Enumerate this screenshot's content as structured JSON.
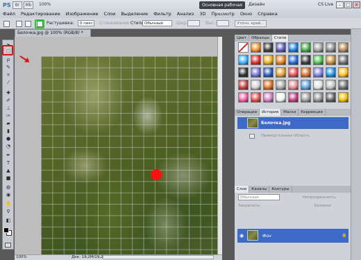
{
  "app": {
    "logo": "PS",
    "zoom": "100%",
    "workspace_active": "Основная рабочая среда",
    "workspace_other": "Дизайн",
    "cs_live": "CS Live"
  },
  "menu": [
    "Файл",
    "Редактирование",
    "Изображение",
    "Слои",
    "Выделение",
    "Фильтр",
    "Анализ",
    "3D",
    "Просмотр",
    "Окно",
    "Справка"
  ],
  "options": {
    "feather_label": "Растушевка:",
    "feather_value": "0 пикс",
    "smoothing": "Сглаживание",
    "style_label": "Стиль:",
    "style_value": "Обычный",
    "width_label": "Шир.:",
    "height_label": "Выс.:",
    "refine_button": "Уточн. край..."
  },
  "document": {
    "tab_title": "Белочка.jpg @ 100% (RGB/8) *",
    "zoom": "100%",
    "doc_info": "Док: 19,2M/19,2M"
  },
  "panels": {
    "top_tabs": [
      "Цвет",
      "Образцы",
      "Стили"
    ],
    "mid_tabs": [
      "Операции",
      "История",
      "Маски",
      "Коррекция"
    ],
    "history_items": [
      "Белочка.jpg",
      "Прямоугольная область"
    ],
    "layer_tabs": [
      "Слои",
      "Каналы",
      "Контуры"
    ],
    "blend_mode": "Обычные",
    "opacity_label": "Непрозрачность:",
    "lock_label": "Закрепить:",
    "fill_label": "Заливка:",
    "layer_name": "Фон"
  },
  "style_colors": [
    "#ff4040",
    "#f09030",
    "#3a3a3a",
    "#5a5ab0",
    "#2080e0",
    "#4aa84a",
    "#a0a0a0",
    "#8a8a8a",
    "#b08a5a",
    "#40b0ff",
    "#d83030",
    "#e8b020",
    "#e08020",
    "#2a6ad0",
    "#3a3a3a",
    "#50c050",
    "#c09040",
    "#707070",
    "#303030",
    "#7070d0",
    "#2a5ab0",
    "#e0a030",
    "#e05050",
    "#d07030",
    "#8080e0",
    "#2090e0",
    "#ffc020",
    "#c04040",
    "#d0d0d0",
    "#e07020",
    "#a8a8a8",
    "#e09090",
    "#60a0e0",
    "#e0e0e0",
    "#c0c0c0",
    "#707070",
    "#f060a0",
    "#e05050",
    "#d080c0",
    "#f0f0f0",
    "#c04080",
    "#a0a0a0",
    "#909090",
    "#606060",
    "#f0c000"
  ]
}
